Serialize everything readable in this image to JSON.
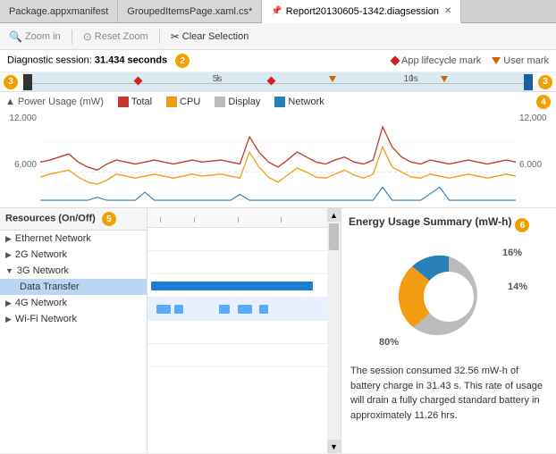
{
  "tabs": [
    {
      "id": "tab1",
      "label": "Package.appxmanifest",
      "active": false,
      "closeable": false
    },
    {
      "id": "tab2",
      "label": "GroupedItemsPage.xaml.cs*",
      "active": false,
      "closeable": false
    },
    {
      "id": "tab3",
      "label": "Report20130605-1342.diagsession",
      "active": true,
      "closeable": true
    }
  ],
  "toolbar": {
    "zoom_in_label": "Zoom in",
    "reset_zoom_label": "Reset Zoom",
    "clear_selection_label": "Clear Selection"
  },
  "diagnostic": {
    "session_label": "Diagnostic session:",
    "duration": "31.434 seconds",
    "app_lifecycle_label": "App lifecycle mark",
    "user_mark_label": "User mark"
  },
  "timeline": {
    "start_badge": "3",
    "end_badge": "3",
    "tick_5s": "5s",
    "tick_10s": "10s"
  },
  "chart": {
    "title": "Power Usage (mW)",
    "expand_icon": "▲",
    "legend": [
      {
        "id": "total",
        "label": "Total",
        "color": "#c0392b"
      },
      {
        "id": "cpu",
        "label": "CPU",
        "color": "#f39c12"
      },
      {
        "id": "display",
        "label": "Display",
        "color": "#bbb"
      },
      {
        "id": "network",
        "label": "Network",
        "color": "#2980b9"
      }
    ],
    "y_left": [
      "12,000",
      "6,000",
      ""
    ],
    "y_right": [
      "12,000",
      "6,000",
      ""
    ],
    "badge": "4"
  },
  "resources": {
    "header": "Resources (On/Off)",
    "badge": "5",
    "items": [
      {
        "id": "ethernet",
        "label": "Ethernet Network",
        "expanded": false,
        "indent": 0
      },
      {
        "id": "2g",
        "label": "2G Network",
        "expanded": false,
        "indent": 0
      },
      {
        "id": "3g",
        "label": "3G Network",
        "expanded": true,
        "indent": 0
      },
      {
        "id": "data-transfer",
        "label": "Data Transfer",
        "expanded": false,
        "indent": 1,
        "selected": true
      },
      {
        "id": "4g",
        "label": "4G Network",
        "expanded": false,
        "indent": 0
      },
      {
        "id": "wifi",
        "label": "Wi-Fi Network",
        "expanded": false,
        "indent": 0
      }
    ]
  },
  "energy_summary": {
    "title": "Energy Usage Summary (mW-h)",
    "badge": "6",
    "segments": [
      {
        "label": "80%",
        "value": 80,
        "color": "#bbb"
      },
      {
        "label": "16%",
        "value": 16,
        "color": "#f39c12"
      },
      {
        "label": "14%",
        "value": 14,
        "color": "#2980b9"
      }
    ],
    "description": "The session consumed 32.56 mW-h of battery charge in 31.43 s. This rate of usage will drain a fully charged standard battery in approximately 11.26 hrs."
  }
}
